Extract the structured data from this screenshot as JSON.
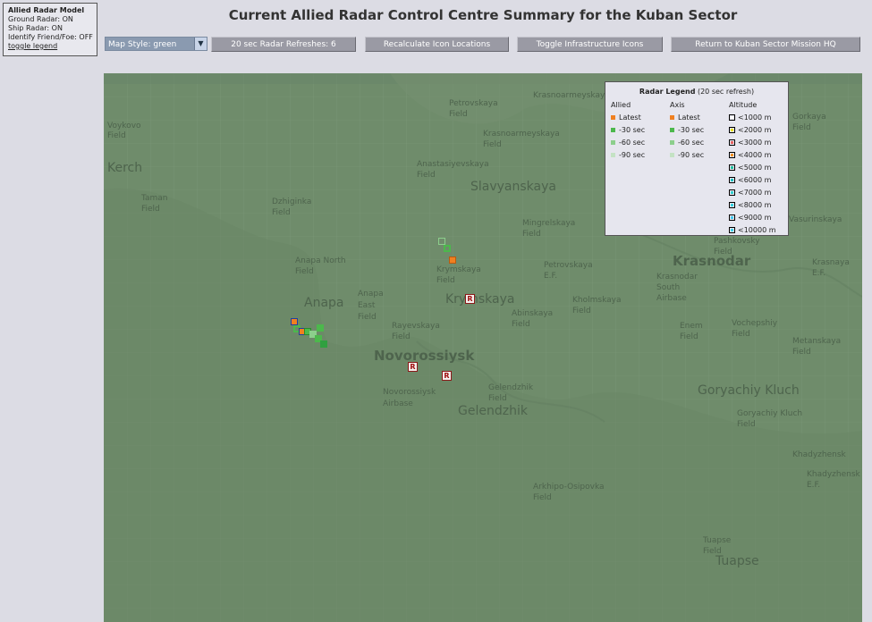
{
  "info": {
    "title": "Allied Radar Model",
    "lines": [
      "Ground Radar: ON",
      "Ship Radar: ON",
      "Identify Friend/Foe: OFF"
    ],
    "toggle_link": "toggle legend"
  },
  "page_title": "Current Allied Radar Control Centre Summary for the Kuban Sector",
  "controls": {
    "map_style": "Map Style: green",
    "refresh_button": "20 sec Radar Refreshes: 6",
    "recalculate_button": "Recalculate Icon Locations",
    "toggle_infra_button": "Toggle Infrastructure Icons",
    "return_button": "Return to Kuban Sector Mission HQ"
  },
  "legend": {
    "title": "Radar Legend",
    "subtitle": "(20 sec refresh)",
    "allied_header": "Allied",
    "axis_header": "Axis",
    "altitude_header": "Altitude",
    "time_rows": [
      "Latest",
      "-30 sec",
      "-60 sec",
      "-90 sec"
    ],
    "time_colors": [
      "#f08020",
      "#4cb84c",
      "#8ccf8c",
      "#c4e2c4"
    ],
    "altitude_rows": [
      "<1000 m",
      "<2000 m",
      "<3000 m",
      "<4000 m",
      "<5000 m",
      "<6000 m",
      "<7000 m",
      "<8000 m",
      "<9000 m",
      "<10000 m"
    ],
    "altitude_colors": [
      "#ffffff",
      "#e8e020",
      "#e86060",
      "#f09020",
      "#20c0a0",
      "#20c0c0",
      "#30d0d0",
      "#30d0e0",
      "#40c8f0",
      "#40d0e8"
    ]
  },
  "map_labels": [
    {
      "text": "Voykovo",
      "size": "s"
    },
    {
      "text": "Field",
      "size": "s"
    },
    {
      "text": "Kerch",
      "size": "b"
    },
    {
      "text": "Taman",
      "size": "s"
    },
    {
      "text": "Field",
      "size": "s"
    },
    {
      "text": "Petrovskaya",
      "size": "s"
    },
    {
      "text": "Field",
      "size": "s"
    },
    {
      "text": "Krasnoarmeyskaya",
      "size": "s"
    },
    {
      "text": "Krasnoarmeyskaya",
      "size": "s"
    },
    {
      "text": "Field",
      "size": "s"
    },
    {
      "text": "Anastasiyevskaya",
      "size": "s"
    },
    {
      "text": "Field",
      "size": "s"
    },
    {
      "text": "Slavyanskaya",
      "size": "b"
    },
    {
      "text": "Dzhiginka",
      "size": "s"
    },
    {
      "text": "Field",
      "size": "s"
    },
    {
      "text": "Mingrelskaya",
      "size": "s"
    },
    {
      "text": "Field",
      "size": "s"
    },
    {
      "text": "Anapa North",
      "size": "s"
    },
    {
      "text": "Field",
      "size": "s"
    },
    {
      "text": "Krymskaya",
      "size": "s"
    },
    {
      "text": "Field",
      "size": "s"
    },
    {
      "text": "Anapa",
      "size": "b"
    },
    {
      "text": "Anapa",
      "size": "s"
    },
    {
      "text": "East",
      "size": "s"
    },
    {
      "text": "Field",
      "size": "s"
    },
    {
      "text": "Krymskaya",
      "size": "b"
    },
    {
      "text": "Abinskaya",
      "size": "s"
    },
    {
      "text": "Field",
      "size": "s"
    },
    {
      "text": "Rayevskaya",
      "size": "s"
    },
    {
      "text": "Field",
      "size": "s"
    },
    {
      "text": "Novorossiysk",
      "size": "bb"
    },
    {
      "text": "Novorossiysk",
      "size": "s"
    },
    {
      "text": "Airbase",
      "size": "s"
    },
    {
      "text": "Gelendzhik",
      "size": "s"
    },
    {
      "text": "Field",
      "size": "s"
    },
    {
      "text": "Gelendzhik",
      "size": "b"
    },
    {
      "text": "Krasnodar",
      "size": "bb"
    },
    {
      "text": "Goryachiy Kluch",
      "size": "b"
    },
    {
      "text": "Goryachiy Kluch",
      "size": "s"
    },
    {
      "text": "Field",
      "size": "s"
    },
    {
      "text": "Arkhipo-Osipovka",
      "size": "s"
    },
    {
      "text": "Field",
      "size": "s"
    },
    {
      "text": "Khadyzhensk",
      "size": "s"
    },
    {
      "text": "Khadyzhensk",
      "size": "s"
    },
    {
      "text": "E.F.",
      "size": "s"
    },
    {
      "text": "Tuapse",
      "size": "s"
    },
    {
      "text": "Field",
      "size": "s"
    },
    {
      "text": "Tuapse",
      "size": "b"
    },
    {
      "text": "Vasurinskaya",
      "size": "s"
    },
    {
      "text": "Pashkovsky",
      "size": "s"
    },
    {
      "text": "Field",
      "size": "s"
    },
    {
      "text": "Krasnodar",
      "size": "s"
    },
    {
      "text": "South",
      "size": "s"
    },
    {
      "text": "Airbase",
      "size": "s"
    },
    {
      "text": "Enem",
      "size": "s"
    },
    {
      "text": "Field",
      "size": "s"
    },
    {
      "text": "Vochepshiy",
      "size": "s"
    },
    {
      "text": "Field",
      "size": "s"
    },
    {
      "text": "Metanskaya",
      "size": "s"
    },
    {
      "text": "Field",
      "size": "s"
    },
    {
      "text": "Kholmskaya",
      "size": "s"
    },
    {
      "text": "Field",
      "size": "s"
    },
    {
      "text": "Petrovskaya",
      "size": "s"
    },
    {
      "text": "E.F.",
      "size": "s"
    },
    {
      "text": "Krasnaya",
      "size": "s"
    },
    {
      "text": "E.F.",
      "size": "s"
    },
    {
      "text": "Gorkaya",
      "size": "s"
    },
    {
      "text": "Field",
      "size": "s"
    }
  ],
  "radar_marker_label": "R"
}
